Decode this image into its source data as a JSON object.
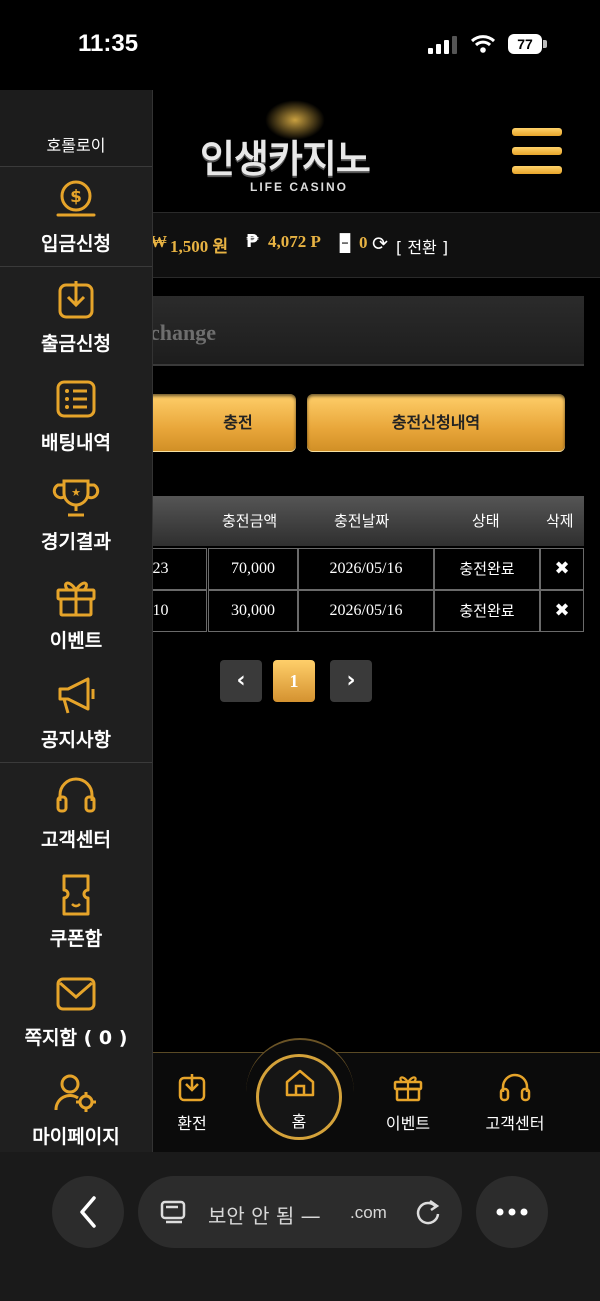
{
  "status_bar": {
    "time": "11:35",
    "battery": "77"
  },
  "header": {
    "logo_title": "인생카지노",
    "logo_subtitle": "LIFE CASINO"
  },
  "info_bar": {
    "money_symbol": "₩",
    "money": "1,500 원",
    "point_symbol": "₱",
    "point": "4,072 P",
    "dice_value": "0",
    "convert_label": "[ 전환 ]"
  },
  "exchange": {
    "title": "change"
  },
  "buttons": {
    "charge": "충전",
    "charge_history": "충전신청내역"
  },
  "table": {
    "headers": [
      "충전금액",
      "충전날짜",
      "상태",
      "삭제"
    ],
    "rows": [
      {
        "time": ":23",
        "amount": "70,000",
        "date": "2026/05/16",
        "status": "충전완료",
        "delete": "✖"
      },
      {
        "time": ":10",
        "amount": "30,000",
        "date": "2026/05/16",
        "status": "충전완료",
        "delete": "✖"
      }
    ]
  },
  "pagination": {
    "prev": "‹",
    "current": "1",
    "next": "›"
  },
  "bottom_nav": [
    {
      "label": "환전",
      "icon": "download-box-icon"
    },
    {
      "label": "홈",
      "icon": "home-icon"
    },
    {
      "label": "이벤트",
      "icon": "gift-icon"
    },
    {
      "label": "고객센터",
      "icon": "headset-icon"
    }
  ],
  "sidebar": {
    "user_name": "호롤로이",
    "items": [
      {
        "label": "입금신청",
        "icon": "coin-deposit-icon"
      },
      {
        "label": "출금신청",
        "icon": "withdraw-icon"
      },
      {
        "label": "배팅내역",
        "icon": "list-icon"
      },
      {
        "label": "경기결과",
        "icon": "trophy-icon"
      },
      {
        "label": "이벤트",
        "icon": "gift-icon"
      },
      {
        "label": "공지사항",
        "icon": "megaphone-icon"
      },
      {
        "label": "고객센터",
        "icon": "headset-icon"
      },
      {
        "label": "쿠폰함",
        "icon": "coupon-icon"
      },
      {
        "label": "쪽지함 ( 0 )",
        "icon": "mail-icon"
      },
      {
        "label": "마이페이지",
        "icon": "user-settings-icon"
      }
    ]
  },
  "browser": {
    "url_label": "보안 안 됨 —",
    "domain": ".com"
  },
  "colors": {
    "accent": "#e6a42a",
    "gold_text": "#e8b343",
    "background": "#000000",
    "sidebar": "#1f1f1f"
  }
}
